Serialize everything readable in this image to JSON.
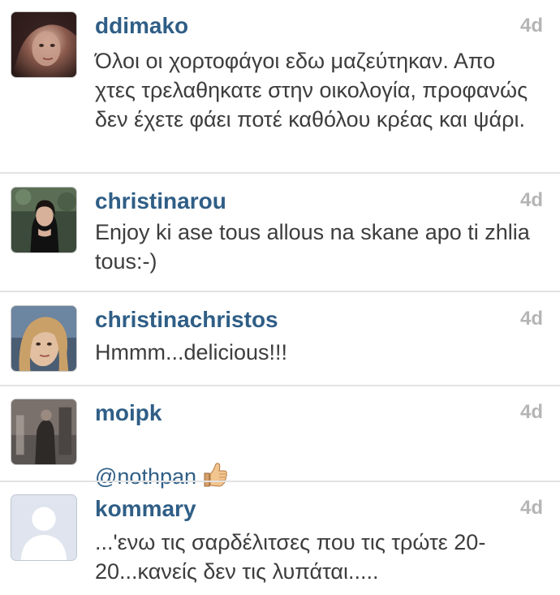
{
  "colors": {
    "username": "#2f5e86",
    "timestamp": "#b5b5b5",
    "body_text": "#3d3d3d",
    "divider": "#e3e3e3"
  },
  "comments": [
    {
      "username": "ddimako",
      "time": "4d",
      "text": "Όλοι οι χορτοφάγοι εδω μαζεύτηκαν. Απο χτες τρελαθηκατε στην οικολογία, προφανώς δεν έχετε φάει ποτέ καθόλου κρέας και ψάρι.",
      "avatar": "profile-photo"
    },
    {
      "username": "christinarou",
      "time": "4d",
      "text": "Enjoy ki ase tous allous na skane apo ti zhlia tous:-)",
      "avatar": "profile-photo"
    },
    {
      "username": "christinachristos",
      "time": "4d",
      "text": "Hmmm...delicious!!!",
      "avatar": "profile-photo"
    },
    {
      "username": "moipk",
      "time": "4d",
      "text": "@nothpan",
      "emoji": "thumbs-up-icon",
      "avatar": "profile-photo"
    },
    {
      "username": "kommary",
      "time": "4d",
      "text": "...'ενω τις σαρδέλιτσες που τις τρώτε 20-20...κανείς δεν τις λυπάται.....",
      "avatar": "default-avatar-icon"
    }
  ]
}
